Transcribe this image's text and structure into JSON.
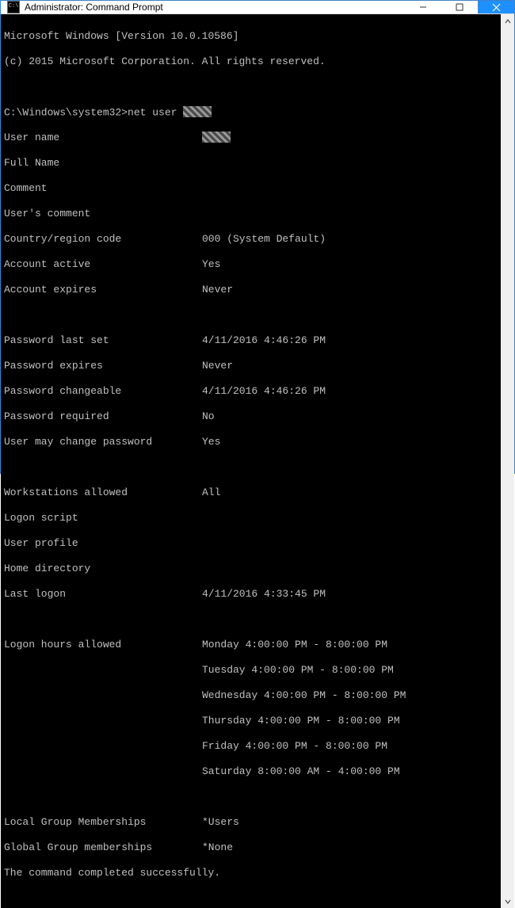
{
  "window": {
    "title": "Administrator: Command Prompt"
  },
  "banner": {
    "line1": "Microsoft Windows [Version 10.0.10586]",
    "line2": "(c) 2015 Microsoft Corporation. All rights reserved."
  },
  "prompt": {
    "path": "C:\\Windows\\system32>",
    "command": "net user "
  },
  "fields": {
    "user_name_lbl": "User name",
    "full_name_lbl": "Full Name",
    "comment_lbl": "Comment",
    "users_comment_lbl": "User's comment",
    "country_lbl": "Country/region code",
    "country_val": "000 (System Default)",
    "acct_active_lbl": "Account active",
    "acct_active_val": "Yes",
    "acct_expires_lbl": "Account expires",
    "acct_expires_val": "Never",
    "pw_last_set_lbl": "Password last set",
    "pw_last_set_val": "4/11/2016 4:46:26 PM",
    "pw_expires_lbl": "Password expires",
    "pw_expires_val": "Never",
    "pw_changeable_lbl": "Password changeable",
    "pw_changeable_val": "4/11/2016 4:46:26 PM",
    "pw_required_lbl": "Password required",
    "pw_required_val": "No",
    "user_may_change_lbl": "User may change password",
    "user_may_change_val": "Yes",
    "workstations_lbl": "Workstations allowed",
    "workstations_val": "All",
    "logon_script_lbl": "Logon script",
    "user_profile_lbl": "User profile",
    "home_dir_lbl": "Home directory",
    "last_logon_lbl": "Last logon",
    "last_logon_val": "4/11/2016 4:33:45 PM",
    "logon_hours_lbl": "Logon hours allowed",
    "logon_hours": [
      "Monday 4:00:00 PM - 8:00:00 PM",
      "Tuesday 4:00:00 PM - 8:00:00 PM",
      "Wednesday 4:00:00 PM - 8:00:00 PM",
      "Thursday 4:00:00 PM - 8:00:00 PM",
      "Friday 4:00:00 PM - 8:00:00 PM",
      "Saturday 8:00:00 AM - 4:00:00 PM"
    ],
    "local_groups_lbl": "Local Group Memberships",
    "local_groups_val": "*Users",
    "global_groups_lbl": "Global Group memberships",
    "global_groups_val": "*None",
    "completed": "The command completed successfully."
  }
}
